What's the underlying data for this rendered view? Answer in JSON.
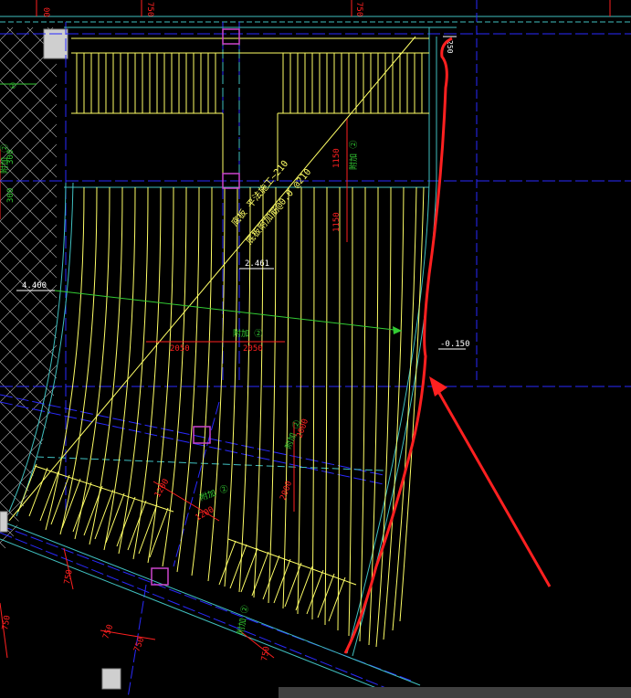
{
  "colors": {
    "background": "#000000",
    "rebar": "#ffff66",
    "grid_blue": "#2a2aff",
    "cyan": "#40c0c0",
    "red": "#ff2020",
    "green": "#33cc33",
    "magenta": "#cc44cc"
  },
  "top_ruler": {
    "ticks": [
      "00",
      "750",
      "750"
    ]
  },
  "labels": {
    "dim_250": "250",
    "dim_2050_left": "2050",
    "dim_2050_right": "2050",
    "dim_1150": "1150",
    "dim_1150b": "1150",
    "dim_1200a": "1200",
    "dim_1200b": "1200",
    "dim_2000a": "2000",
    "dim_2000b": "2000",
    "dim_750a": "750",
    "dim_750b": "750",
    "dim_750c": "750",
    "dim_750d": "750",
    "dim_750e": "750",
    "dim_300a": "300",
    "dim_300b": "300",
    "elev_4400": "4.400",
    "elev_2461": "2.461",
    "elev_neg150": "-0.150",
    "bar_mark_a": "附加 ②",
    "bar_mark_b": "附加 ②",
    "bar_mark_c": "附加 ②",
    "bar_mark_d": "附加 ②",
    "bar_mark_e": "附加 ②",
    "bar_mark_f": "附加 ②",
    "circle_left": "①",
    "diag_text1": "底板 平法施工~210",
    "diag_text2": "底板附加筋@0.0 @210"
  }
}
